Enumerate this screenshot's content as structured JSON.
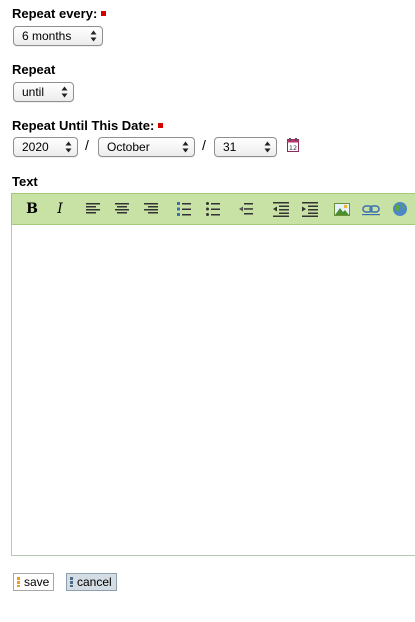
{
  "repeat_every": {
    "label": "Repeat every:",
    "value": "6 months"
  },
  "repeat": {
    "label": "Repeat",
    "value": "until"
  },
  "repeat_until": {
    "label": "Repeat Until This Date:",
    "year": "2020",
    "month": "October",
    "day": "31",
    "separator": "/"
  },
  "text_field": {
    "label": "Text",
    "toolbar": {
      "bold": "B",
      "italic": "I"
    },
    "content": ""
  },
  "actions": {
    "save_label": "save",
    "cancel_label": "cancel"
  },
  "colors": {
    "required_marker": "#d40000",
    "toolbar_bg": "#c8e1a4",
    "cancel_bg": "#d4dde3"
  },
  "icons": {
    "calendar": "calendar-icon",
    "align_left": "align-left-icon",
    "align_center": "align-center-icon",
    "align_right": "align-right-icon",
    "ordered_list": "ordered-list-icon",
    "unordered_list": "unordered-list-icon",
    "outdent": "outdent-icon",
    "indent": "indent-icon",
    "insert_image": "insert-image-icon",
    "insert_link": "insert-link-icon",
    "globe": "globe-icon"
  }
}
